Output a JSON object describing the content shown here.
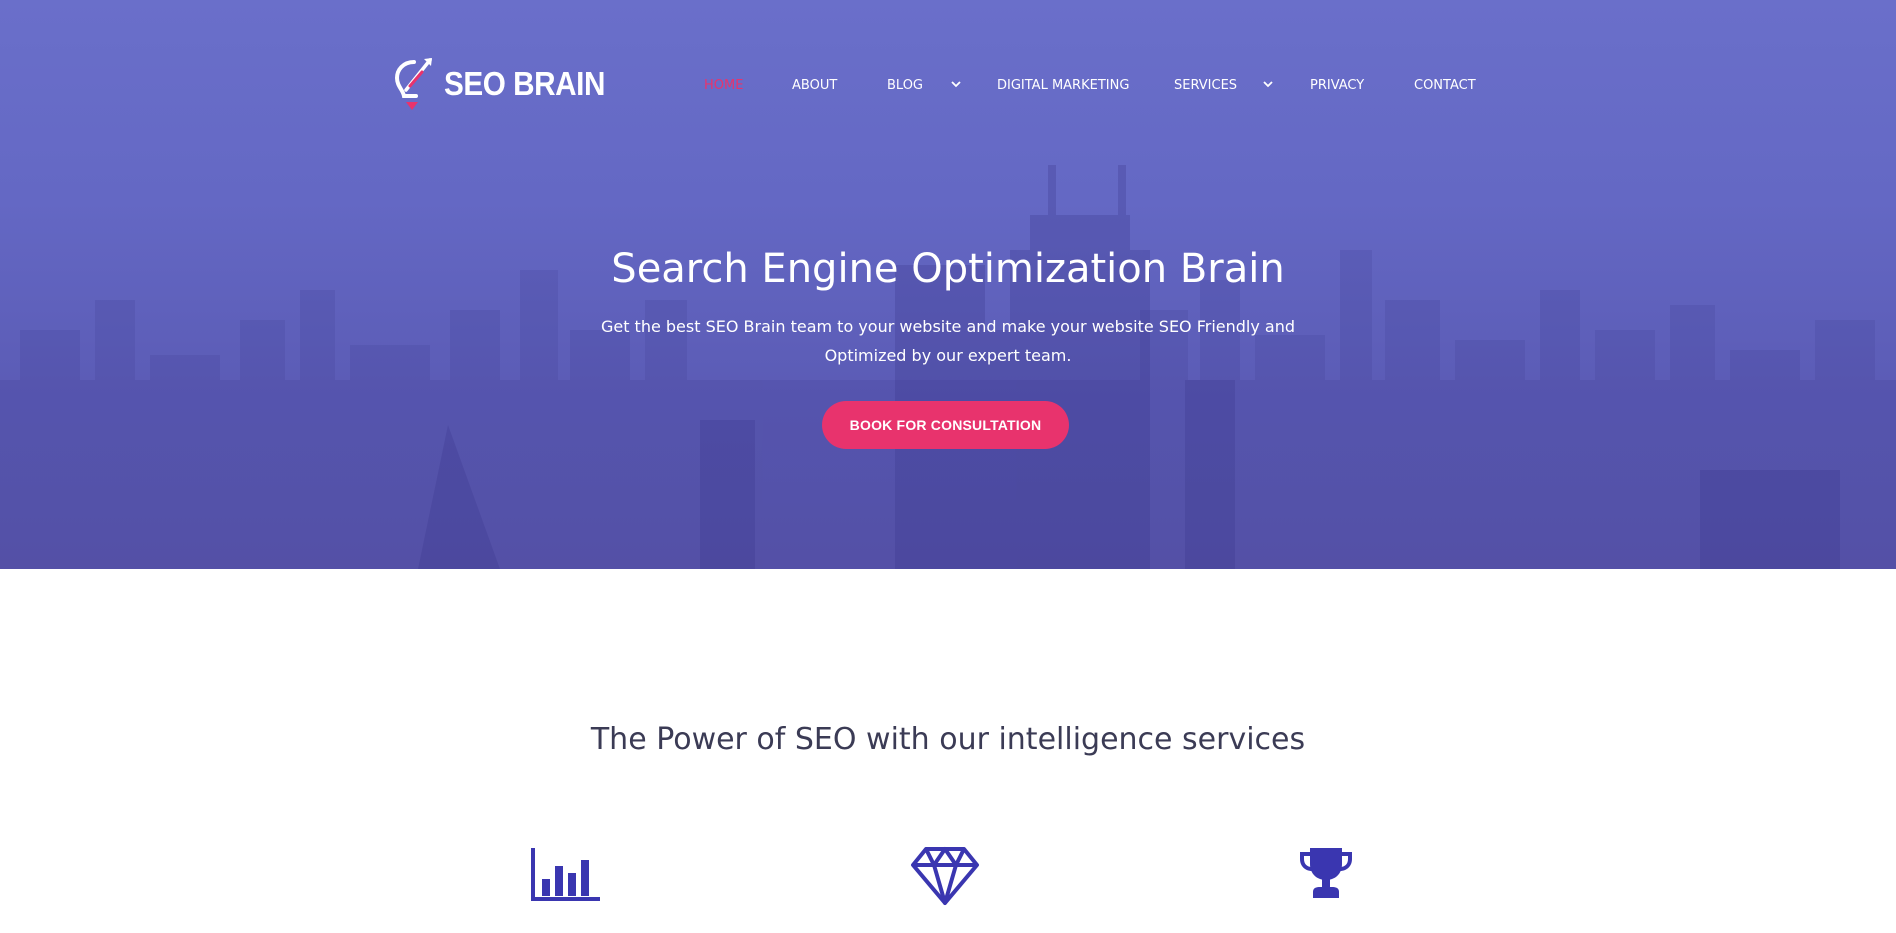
{
  "brand": {
    "name": "SEO BRAIN"
  },
  "nav": {
    "items": [
      {
        "label": "HOME",
        "active": true
      },
      {
        "label": "ABOUT"
      },
      {
        "label": "BLOG",
        "has_dropdown": true
      },
      {
        "label": "DIGITAL MARKETING"
      },
      {
        "label": "SERVICES",
        "has_dropdown": true
      },
      {
        "label": "PRIVACY"
      },
      {
        "label": "CONTACT"
      }
    ]
  },
  "hero": {
    "title": "Search Engine Optimization Brain",
    "subtitle": "Get the best SEO Brain team to your website and make your website SEO Friendly and Optimized by our expert team.",
    "cta_label": "BOOK FOR CONSULTATION"
  },
  "services": {
    "title": "The Power of SEO with our intelligence services",
    "icons": [
      "bar-chart-icon",
      "diamond-icon",
      "trophy-icon"
    ]
  },
  "colors": {
    "accent": "#e8336d",
    "hero_top": "#6a6fca",
    "hero_bottom": "#5a56ac",
    "icon_blue": "#3a36b0",
    "heading_dark": "#3b3b55"
  }
}
